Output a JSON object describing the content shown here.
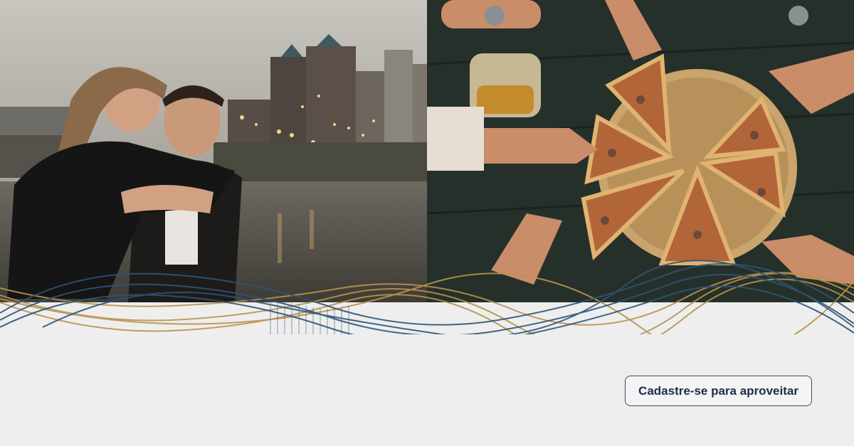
{
  "cta": {
    "label": "Cadastre-se para aproveitar"
  },
  "colors": {
    "background": "#eeeeee",
    "wave_blue": "#2e5477",
    "wave_gold": "#b8934e",
    "button_border": "#3a4a66",
    "button_text": "#1f2d4a"
  },
  "images": {
    "left": "couple-by-river-city-photo",
    "right": "friends-sharing-pizza-photo"
  }
}
